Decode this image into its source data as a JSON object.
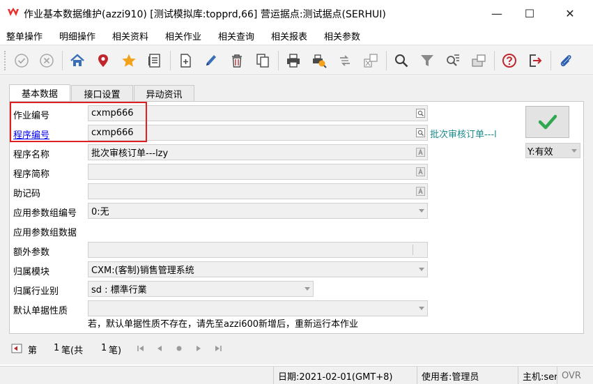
{
  "window": {
    "title": "作业基本数据维护(azzi910)      [测试模拟库:topprd,66]      营运据点:测试据点(SERHUI)",
    "minimize_glyph": "—",
    "maximize_glyph": "☐",
    "close_glyph": "✕"
  },
  "menu": [
    "整单操作",
    "明细操作",
    "相关资料",
    "相关作业",
    "相关查询",
    "相关报表",
    "相关参数"
  ],
  "toolbar": {
    "icons": [
      "confirm-icon",
      "cancel-icon",
      "home-icon",
      "location-pin-icon",
      "star-icon",
      "list-icon",
      "new-doc-icon",
      "edit-pencil-icon",
      "delete-trash-icon",
      "copy-icon",
      "print-icon",
      "print-preview-icon",
      "transfer-icon",
      "export-icon",
      "search-icon",
      "filter-icon",
      "query-list-icon",
      "archive-icon",
      "help-icon",
      "exit-icon",
      "attachment-icon"
    ]
  },
  "tabs": [
    "基本数据",
    "接口设置",
    "异动资讯"
  ],
  "form": {
    "job_no_label": "作业编号",
    "job_no_value": "cxmp666",
    "program_no_label": "程序编号",
    "program_no_value": "cxmp666",
    "program_desc_side": "批次审核订单---l",
    "program_name_label": "程序名称",
    "program_name_value": "批次审核订单---lzy",
    "program_short_label": "程序简称",
    "program_short_value": "",
    "mnemonic_label": "助记码",
    "mnemonic_value": "",
    "param_group_no_label": "应用参数组编号",
    "param_group_no_value": "0:无",
    "param_group_data_label": "应用参数组数据",
    "extra_param_label": "额外参数",
    "extra_param_value": "",
    "module_label": "归属模块",
    "module_value": "CXM:(客制)销售管理系统",
    "industry_label": "归属行业别",
    "industry_value": "sd : 標準行業",
    "doc_nature_label": "默认单据性质",
    "doc_nature_value": "",
    "hint": "若，默认单据性质不存在，请先至azzi600新增后，重新运行本作业",
    "status_value": "Y:有效"
  },
  "navigation": {
    "prefix": "第",
    "current": "1",
    "mid": "笔(共",
    "total": "1",
    "suffix": "笔)"
  },
  "statusbar": {
    "date": "日期:2021-02-01(GMT+8)",
    "user": "使用者:管理员",
    "host": "主机:serhu",
    "mode": "OVR"
  },
  "colors": {
    "brand": "#e5322d",
    "highlight_border": "#e02020",
    "confirm_check": "#2fa84f",
    "link": "#0000ee",
    "side_desc": "#1a8a8a"
  }
}
